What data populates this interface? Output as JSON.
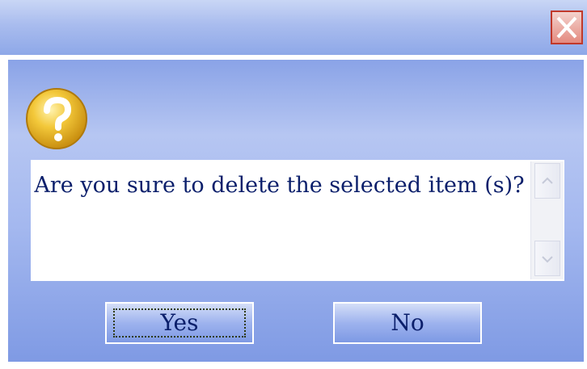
{
  "window": {
    "title": "",
    "close_icon": "close-icon",
    "accent_color": "#c0392b"
  },
  "dialog": {
    "icon": "question-icon",
    "message": "Are you sure to delete the selected item (s)?",
    "scroll_up_icon": "chevron-up-icon",
    "scroll_down_icon": "chevron-down-icon"
  },
  "buttons": {
    "yes_label": "Yes",
    "no_label": "No",
    "focused": "yes"
  },
  "colors": {
    "text": "#0b1f6b",
    "body_gradient_top": "#8aa3e7",
    "body_gradient_bottom": "#7f9ae4",
    "icon_gold": "#e8b420"
  }
}
